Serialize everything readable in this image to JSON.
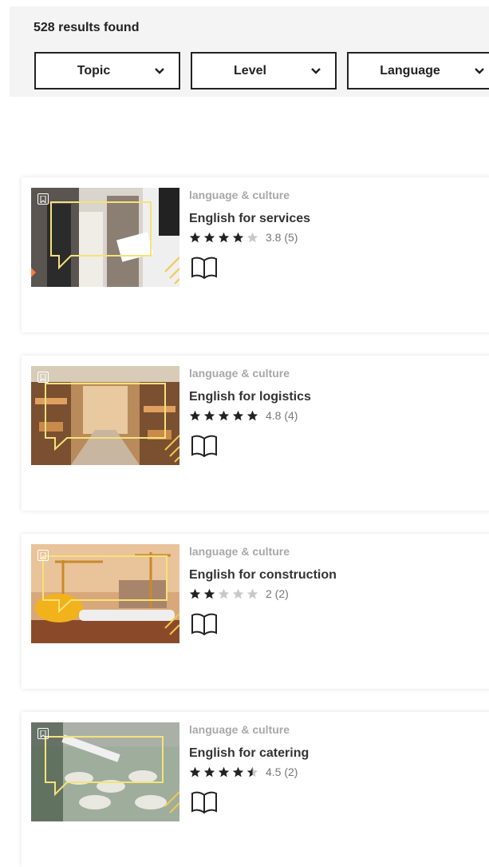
{
  "results": {
    "count_label": "528 results found"
  },
  "filters": [
    {
      "label": "Topic"
    },
    {
      "label": "Level"
    },
    {
      "label": "Language"
    }
  ],
  "courses": [
    {
      "category": "language & culture",
      "title": "English for services",
      "rating": 3.8,
      "rating_label": "3.8 (5)",
      "stars_filled": [
        1,
        1,
        1,
        1,
        0
      ],
      "thumbnail_scene": "services"
    },
    {
      "category": "language & culture",
      "title": "English for logistics",
      "rating": 4.8,
      "rating_label": "4.8 (4)",
      "stars_filled": [
        1,
        1,
        1,
        1,
        1
      ],
      "thumbnail_scene": "warehouse"
    },
    {
      "category": "language & culture",
      "title": "English for construction",
      "rating": 2,
      "rating_label": "2 (2)",
      "stars_filled": [
        1,
        1,
        0,
        0,
        0
      ],
      "thumbnail_scene": "construction"
    },
    {
      "category": "language & culture",
      "title": "English for catering",
      "rating": 4.5,
      "rating_label": "4.5 (2)",
      "stars_filled": [
        1,
        1,
        1,
        1,
        0.5
      ],
      "thumbnail_scene": "catering"
    }
  ],
  "colors": {
    "star_filled": "#222222",
    "star_empty": "#c8c8c8",
    "accent_outline": "#f5e27a"
  },
  "icons": {
    "filter_chevron": "chevron-down-icon",
    "bookmark": "bookmark-icon",
    "format": "book-icon"
  }
}
